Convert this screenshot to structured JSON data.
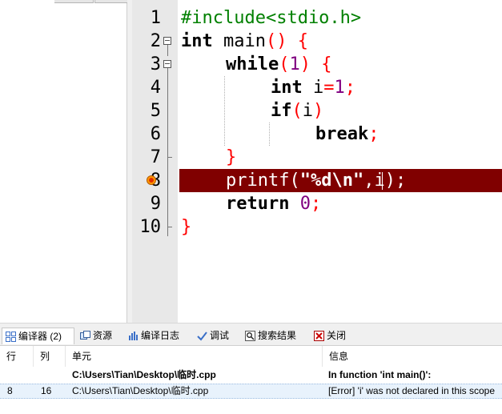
{
  "editor": {
    "line_numbers": [
      "1",
      "2",
      "3",
      "4",
      "5",
      "6",
      "7",
      "8",
      "9",
      "10"
    ],
    "lines": {
      "l1": [
        "#include<stdio.h>"
      ],
      "l2": [
        "int",
        " main",
        "()",
        " {"
      ],
      "l3": [
        "while",
        "(",
        "1",
        ")",
        " {"
      ],
      "l4": [
        "int",
        " i",
        "=",
        "1",
        ";"
      ],
      "l5": [
        "if",
        "(",
        "i",
        ")"
      ],
      "l6": [
        "break",
        ";"
      ],
      "l7": [
        "}"
      ],
      "l8": [
        "printf",
        "(",
        "\"%d\\n\"",
        ",",
        "i",
        ");"
      ],
      "l9": [
        "return",
        " ",
        "0",
        ";"
      ],
      "l10": [
        "}"
      ]
    },
    "error_line": "8",
    "colors": {
      "keyword": "#000000",
      "preprocessor": "#008000",
      "operator": "#ff0000",
      "number": "#800080",
      "error_highlight": "#800000"
    }
  },
  "bottom_tabs": [
    {
      "label": "编译器 (2)",
      "icon": "compiler-grid-icon"
    },
    {
      "label": "资源",
      "icon": "resources-icon"
    },
    {
      "label": "编译日志",
      "icon": "compile-log-chart-icon"
    },
    {
      "label": "调试",
      "icon": "debug-check-icon"
    },
    {
      "label": "搜索结果",
      "icon": "search-results-icon"
    },
    {
      "label": "关闭",
      "icon": "close-icon"
    }
  ],
  "messages": {
    "headers": [
      "行",
      "列",
      "单元",
      "信息"
    ],
    "rows": [
      {
        "line": "",
        "col": "",
        "unit": "C:\\Users\\Tian\\Desktop\\临时.cpp",
        "message": "In function 'int main()':",
        "bold": true
      },
      {
        "line": "8",
        "col": "16",
        "unit": "C:\\Users\\Tian\\Desktop\\临时.cpp",
        "message": "[Error] 'i' was not declared in this scope",
        "bold": false
      }
    ]
  }
}
